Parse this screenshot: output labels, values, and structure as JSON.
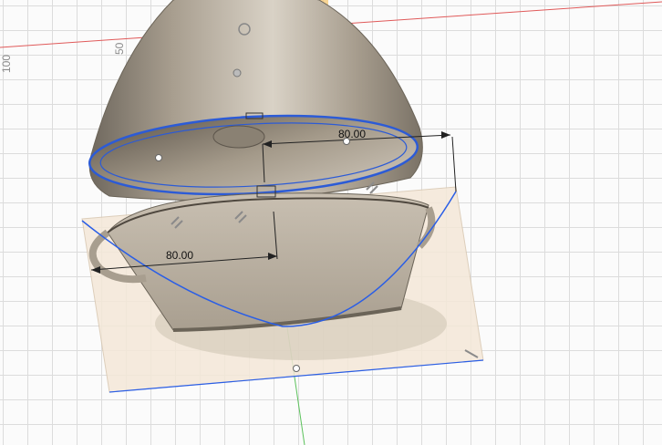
{
  "viewport": {
    "grid_labels": [
      "100",
      "50"
    ],
    "axis_colors": {
      "x": "#e05a5a",
      "y": "#5cc25c"
    }
  },
  "dimensions": {
    "upper": "80.00",
    "lower": "80.00"
  },
  "colors": {
    "body_fill": "#b5aa9a",
    "body_dark": "#7f776b",
    "edge_highlight": "#2c5bd6",
    "sketch_curve": "#2a5ee6",
    "sketch_plane": "#f4e8d8",
    "origin_plane": "#f6c46a"
  },
  "icons": [
    "constraint-icon",
    "sketch-point-icon",
    "origin-point-icon"
  ]
}
